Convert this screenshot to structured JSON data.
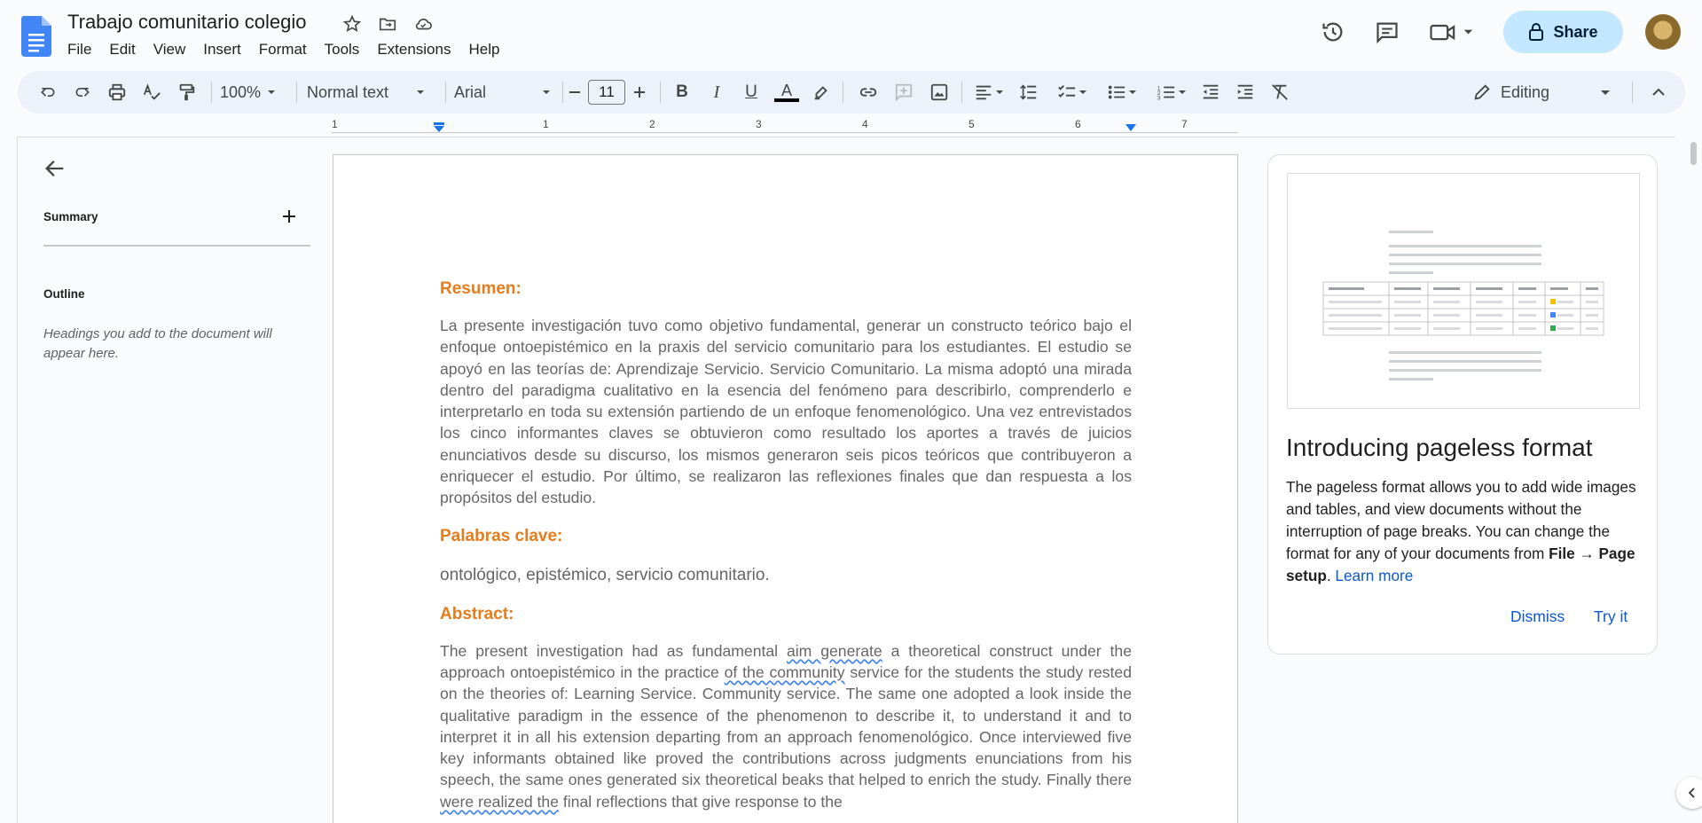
{
  "app": {
    "doc_title": "Trabajo comunitario colegio",
    "menu": [
      "File",
      "Edit",
      "View",
      "Insert",
      "Format",
      "Tools",
      "Extensions",
      "Help"
    ],
    "share_label": "Share"
  },
  "toolbar": {
    "zoom": "100%",
    "style": "Normal text",
    "font": "Arial",
    "font_size": "11",
    "mode": "Editing"
  },
  "ruler": {
    "numbers": [
      "1",
      "1",
      "2",
      "3",
      "4",
      "5",
      "6",
      "7"
    ]
  },
  "outline_panel": {
    "summary_label": "Summary",
    "outline_label": "Outline",
    "hint": "Headings you add to the document will appear here."
  },
  "document": {
    "resumen_heading": "Resumen:",
    "resumen_text": "La presente investigación tuvo como objetivo fundamental, generar un constructo teórico bajo el enfoque ontoepistémico en la praxis del servicio comunitario para los estudiantes. El estudio se apoyó en las teorías de: Aprendizaje Servicio. Servicio Comunitario. La misma adoptó una mirada dentro del paradigma cualitativo en la esencia del fenómeno para describirlo, comprenderlo e interpretarlo en toda su extensión partiendo de un enfoque fenomenológico. Una vez entrevistados los cinco informantes claves se obtuvieron como resultado los aportes a través de juicios enunciativos desde su discurso, los mismos generaron seis picos teóricos que contribuyeron a enriquecer el estudio. Por último, se realizaron las reflexiones finales que dan respuesta a los propósitos del estudio.",
    "keywords_heading": "Palabras clave:",
    "keywords_text": "ontológico, epistémico, servicio comunitario.",
    "abstract_heading": "Abstract:",
    "abstract_p1": "The present investigation had as fundamental ",
    "abstract_s1": "aim generate",
    "abstract_p2": " a theoretical construct under the approach ontoepistémico in the practice ",
    "abstract_s2": "of the community",
    "abstract_p3": " service for the students the study rested on the theories of: Learning Service. Community service. The same one adopted a look inside the qualitative paradigm in the essence of the phenomenon to describe it, to understand it and to interpret it in all his extension departing from an approach fenomenológico. Once interviewed five key informants obtained like proved the contributions across judgments enunciations from his speech, the same ones generated six theoretical beaks that helped to enrich the study. Finally there ",
    "abstract_s3": "were realized the",
    "abstract_p4": " final reflections that give response to the"
  },
  "card": {
    "title": "Introducing pageless format",
    "body_1": "The pageless format allows you to add wide images and tables, and view documents without the interruption of page breaks. You can change the format for any of your documents from ",
    "body_bold_1": "File → Page setup",
    "body_2": ". ",
    "learn_more": "Learn more",
    "dismiss": "Dismiss",
    "try_it": "Try it"
  },
  "colors": {
    "heading_orange": "#e67c1b",
    "share_bg": "#c2e7ff",
    "link_blue": "#0b57d0"
  }
}
